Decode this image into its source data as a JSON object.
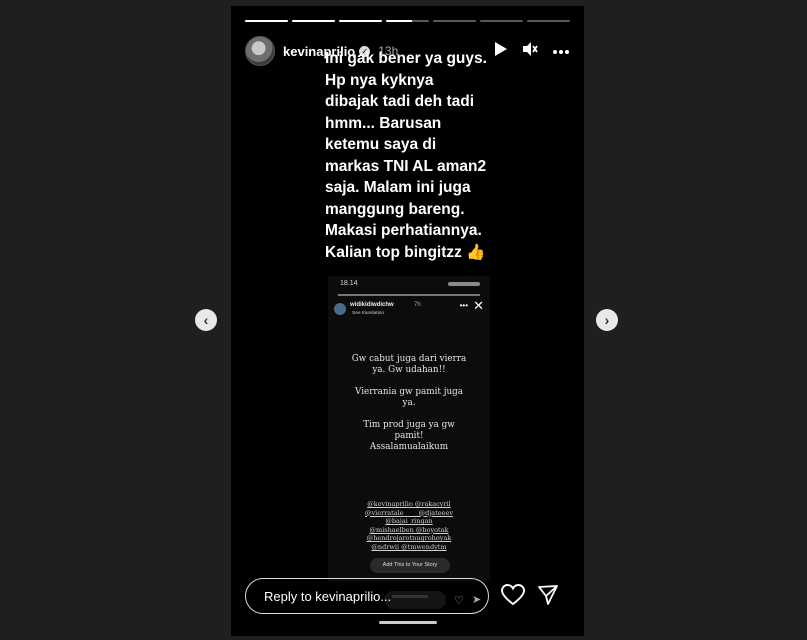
{
  "progress": {
    "segments": [
      1,
      1,
      1,
      0.6,
      0,
      0,
      0
    ]
  },
  "header": {
    "username": "kevinaprilio",
    "time": "13h",
    "play_icon": "play-icon",
    "mute_icon": "mute-icon",
    "more_icon": "more-icon"
  },
  "caption": "Ini gak bener ya guys.\nHp nya kyknya\ndibajak tadi deh tadi\nhmm... Barusan\nketemu saya di\nmarkas TNI AL aman2\nsaja. Malam ini juga\nmanggung bareng.\nMakasi perhatiannya.\nKalian top bingitzz 👍",
  "inner_story": {
    "status_time": "18.14",
    "username": "widikidiwdichw",
    "time": "7h",
    "see_translation": "See translation",
    "message": "Gw cabut juga dari vierra\nya. Gw udahan!!\n\nVierrania gw pamit juga\nya.\n\nTim prod juga ya gw\npamit!\nAssalamualaikum",
    "tags": "@kevinaprilio @rakacyril\n@vierratale____ @djateeev\n@bajai_ringan\n@mishaelben @boyotak\n@hendrojarotnugrohoyak\n@ndrwij @tmwendytm",
    "add_button": "Add This to Your Story"
  },
  "reply": {
    "placeholder": "Reply to kevinaprilio..."
  },
  "colors": {
    "background": "#1f1f1f",
    "story_bg": "#000000"
  }
}
